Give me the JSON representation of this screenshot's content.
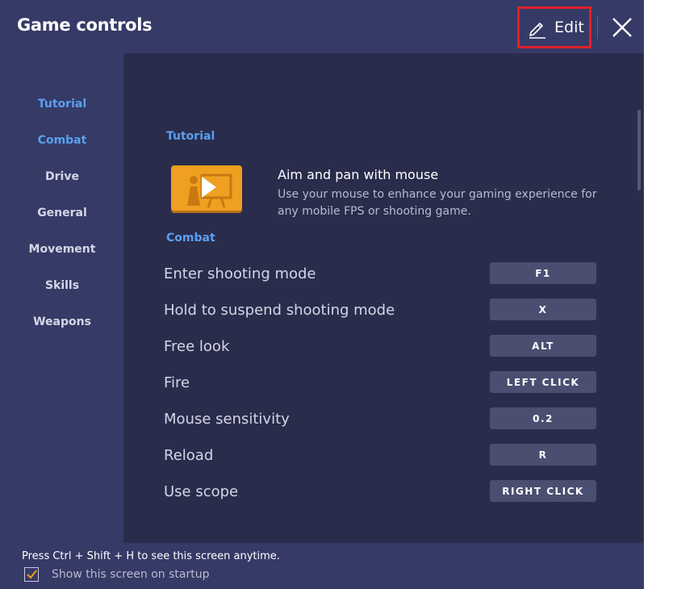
{
  "window": {
    "title": "Game controls",
    "edit_label": "Edit"
  },
  "sidebar": {
    "items": [
      {
        "label": "Tutorial",
        "active": true
      },
      {
        "label": "Combat",
        "active": true
      },
      {
        "label": "Drive",
        "active": false
      },
      {
        "label": "General",
        "active": false
      },
      {
        "label": "Movement",
        "active": false
      },
      {
        "label": "Skills",
        "active": false
      },
      {
        "label": "Weapons",
        "active": false
      }
    ]
  },
  "tutorial": {
    "heading": "Tutorial",
    "title": "Aim and pan with mouse",
    "description": "Use your mouse to enhance your gaming experience for any mobile FPS or shooting game.",
    "thumbnail_icon": "play-video-icon"
  },
  "combat": {
    "heading": "Combat",
    "rows": [
      {
        "label": "Enter shooting mode",
        "key": "F1"
      },
      {
        "label": "Hold to suspend shooting mode",
        "key": "X"
      },
      {
        "label": "Free look",
        "key": "ALT"
      },
      {
        "label": "Fire",
        "key": "LEFT CLICK"
      },
      {
        "label": "Mouse sensitivity",
        "key": "0.2"
      },
      {
        "label": "Reload",
        "key": "R"
      },
      {
        "label": "Use scope",
        "key": "RIGHT CLICK"
      }
    ]
  },
  "footer": {
    "hint": "Press Ctrl + Shift + H to see this screen anytime.",
    "checkbox_label": "Show this screen on startup",
    "checkbox_checked": true
  },
  "colors": {
    "titlebar": "#363a66",
    "content_bg": "#2a2c4c",
    "accent_blue": "#5aa0f0",
    "key_bg": "#4a4e70",
    "highlight_red": "#e0202a",
    "thumbnail_orange": "#f0a020",
    "checkmark_orange": "#f0a020"
  }
}
